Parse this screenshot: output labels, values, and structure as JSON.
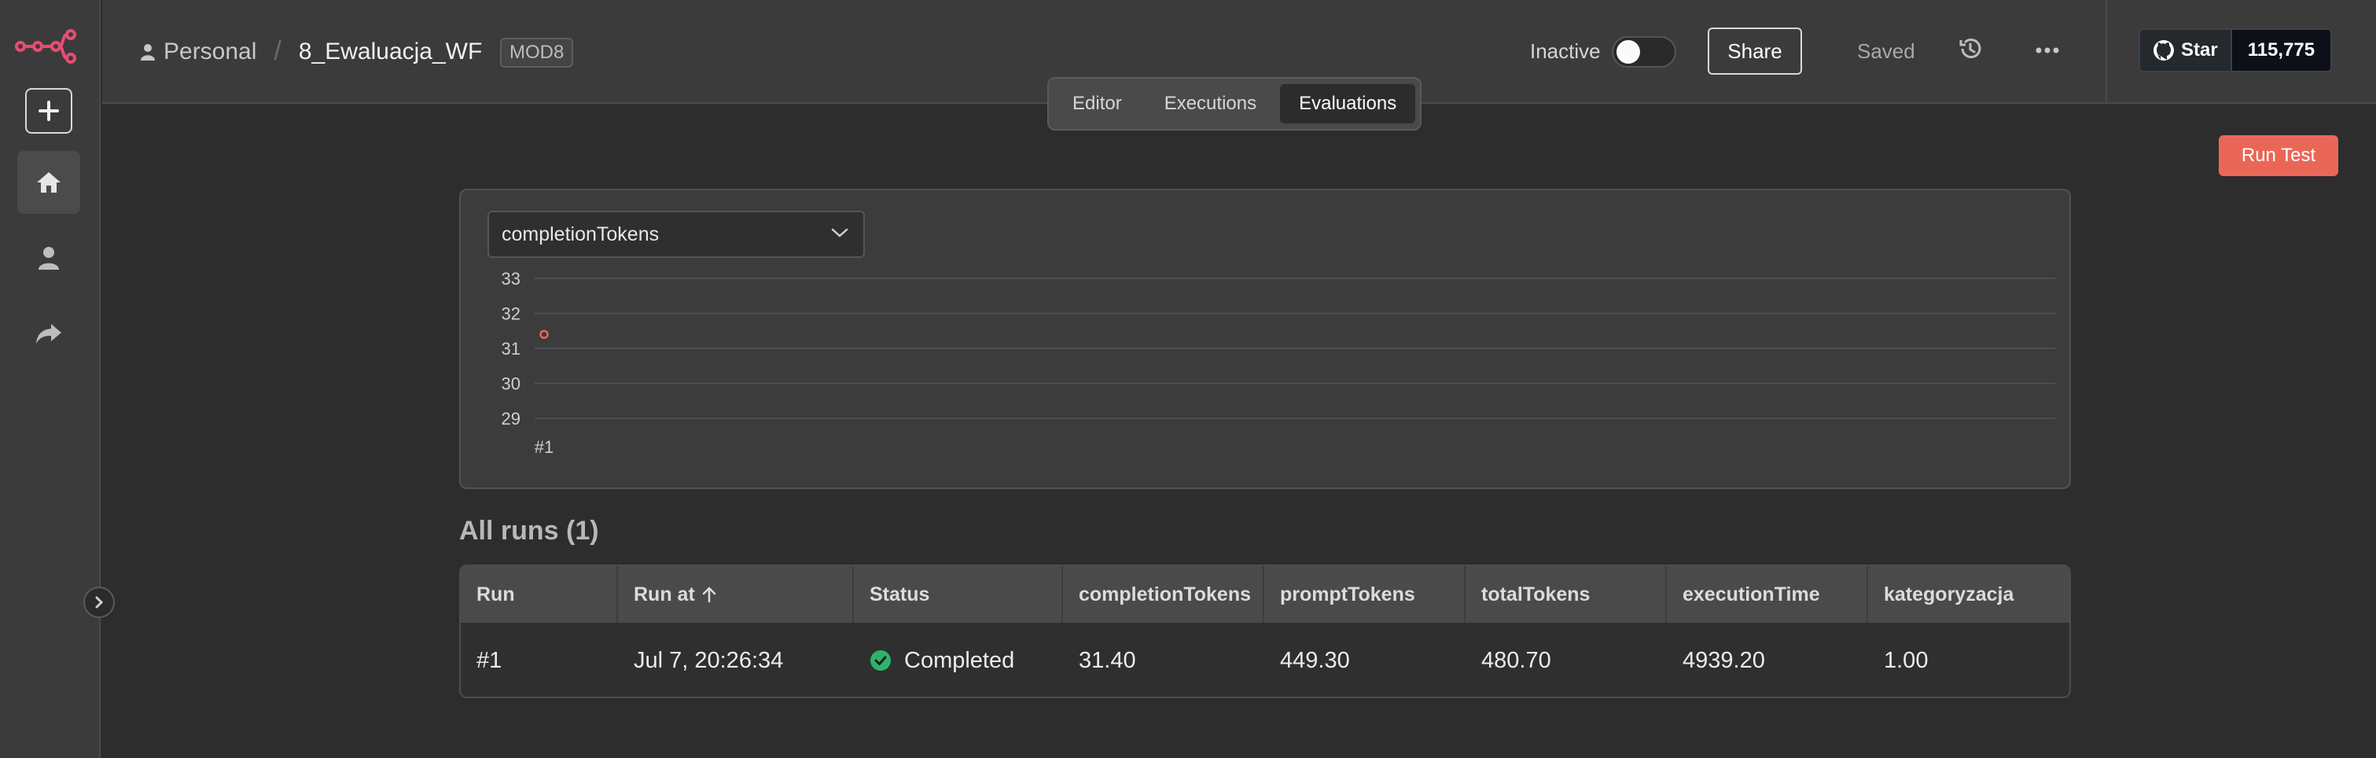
{
  "header": {
    "breadcrumb_owner": "Personal",
    "workflow_name": "8_Ewaluacja_WF",
    "tag": "MOD8",
    "active_label": "Inactive",
    "active": false,
    "share_label": "Share",
    "save_status": "Saved",
    "github_star_label": "Star",
    "github_star_count": "115,775"
  },
  "tabs": [
    {
      "label": "Editor",
      "active": false
    },
    {
      "label": "Executions",
      "active": false
    },
    {
      "label": "Evaluations",
      "active": true
    }
  ],
  "toolbar": {
    "run_test_label": "Run Test"
  },
  "metric_selector": {
    "value": "completionTokens"
  },
  "chart_data": {
    "type": "scatter",
    "x_labels": [
      "#1"
    ],
    "values": [
      31.4
    ],
    "y_ticks": [
      29,
      30,
      31,
      32,
      33
    ],
    "ylim": [
      29,
      33
    ],
    "point_color": "#ea6757"
  },
  "runs": {
    "title": "All runs (1)",
    "columns": [
      "Run",
      "Run at",
      "Status",
      "completionTokens",
      "promptTokens",
      "totalTokens",
      "executionTime",
      "kategoryzacja"
    ],
    "rows": [
      {
        "run": "#1",
        "run_at": "Jul 7, 20:26:34",
        "status": "Completed",
        "completionTokens": "31.40",
        "promptTokens": "449.30",
        "totalTokens": "480.70",
        "executionTime": "4939.20",
        "kategoryzacja": "1.00"
      }
    ]
  },
  "colors": {
    "accent": "#ea6757",
    "success": "#2fb36b",
    "background": "#2d2d2d"
  }
}
